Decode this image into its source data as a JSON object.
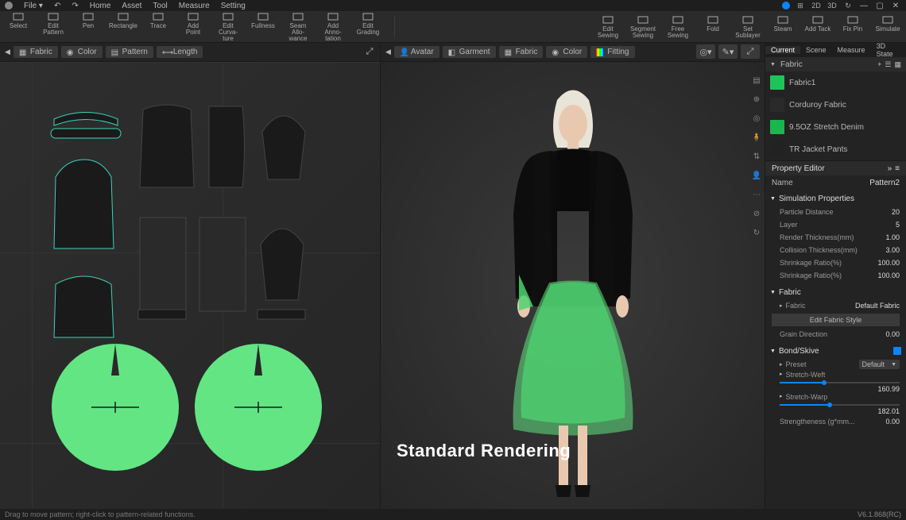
{
  "menubar": {
    "file": "File",
    "items": [
      "Home",
      "Asset",
      "Tool",
      "Measure",
      "Setting"
    ],
    "mode2d": "2D",
    "mode3d": "3D",
    "sync_icon": "↻"
  },
  "toolbar": {
    "groupA": [
      {
        "id": "select",
        "label": "Select"
      },
      {
        "id": "edit-pattern",
        "label": "Edit Pattern"
      },
      {
        "id": "pen",
        "label": "Pen"
      },
      {
        "id": "rectangle",
        "label": "Rectangle"
      },
      {
        "id": "trace",
        "label": "Trace"
      },
      {
        "id": "add-point",
        "label": "Add Point"
      },
      {
        "id": "edit-curvature",
        "label": "Edit Curva-\nture"
      },
      {
        "id": "fullness",
        "label": "Fullness"
      },
      {
        "id": "seam-allowance",
        "label": "Seam Allo-\nwance"
      },
      {
        "id": "add-annotation",
        "label": "Add Anno-\ntation"
      },
      {
        "id": "edit-grading",
        "label": "Edit Grading"
      }
    ],
    "groupB": [
      {
        "id": "edit-sewing",
        "label": "Edit Sewing"
      },
      {
        "id": "segment-sewing",
        "label": "Segment\nSewing"
      },
      {
        "id": "free-sewing",
        "label": "Free Sewing"
      },
      {
        "id": "fold",
        "label": "Fold"
      },
      {
        "id": "set-sublayer",
        "label": "Set Sublayer"
      },
      {
        "id": "steam",
        "label": "Steam"
      },
      {
        "id": "add-tack",
        "label": "Add Tack"
      },
      {
        "id": "fix-pin",
        "label": "Fix Pin"
      },
      {
        "id": "simulate",
        "label": "Simulate"
      }
    ]
  },
  "panel2d_chips": [
    "Fabric",
    "Color",
    "Pattern",
    "Length"
  ],
  "panel3d_chips": [
    "Avatar",
    "Garment",
    "Fabric",
    "Color"
  ],
  "fitting_label": "Fitting",
  "render_label": "Standard Rendering",
  "right": {
    "tabs": [
      "Current",
      "Scene",
      "Measure",
      "3D State"
    ],
    "fabric_header": "Fabric",
    "fabrics": [
      {
        "name": "Fabric1",
        "sw": "sw-green"
      },
      {
        "name": "Corduroy Fabric",
        "sw": "sw-dark"
      },
      {
        "name": "9.5OZ Stretch Denim",
        "sw": "sw-green2"
      },
      {
        "name": "TR Jacket Pants",
        "sw": "sw-dark2"
      }
    ],
    "prop_editor_header": "Property Editor",
    "name_label": "Name",
    "name_value": "Pattern2",
    "sim_header": "Simulation Properties",
    "sim_fields": [
      {
        "label": "Particle Distance",
        "value": "20"
      },
      {
        "label": "Layer",
        "value": "5"
      },
      {
        "label": "Render Thickness(mm)",
        "value": "1.00"
      },
      {
        "label": "Collision Thickness(mm)",
        "value": "3.00"
      },
      {
        "label": "Shrinkage Ratio(%)",
        "value": "100.00"
      },
      {
        "label": "Shrinkage Ratio(%)",
        "value": "100.00"
      }
    ],
    "fabric_sec": "Fabric",
    "fabric_field_label": "Fabric",
    "fabric_field_value": "Default Fabric",
    "edit_style_btn": "Edit  Fabric Style",
    "grain_label": "Grain Direction",
    "grain_value": "0.00",
    "bond_header": "Bond/Skive",
    "preset_label": "Preset",
    "preset_value": "Default",
    "stretch_weft_label": "Stretch-Weft",
    "stretch_weft_value": "160.99",
    "stretch_warp_label": "Stretch-Warp",
    "stretch_warp_value": "182.01",
    "strengtheness_label": "Strengtheness  (g*mm...",
    "strengtheness_value": "0.00"
  },
  "statusbar": {
    "hint": "Drag to move pattern; right-click to pattern-related functions.",
    "version": "V6.1.868(RC)"
  }
}
